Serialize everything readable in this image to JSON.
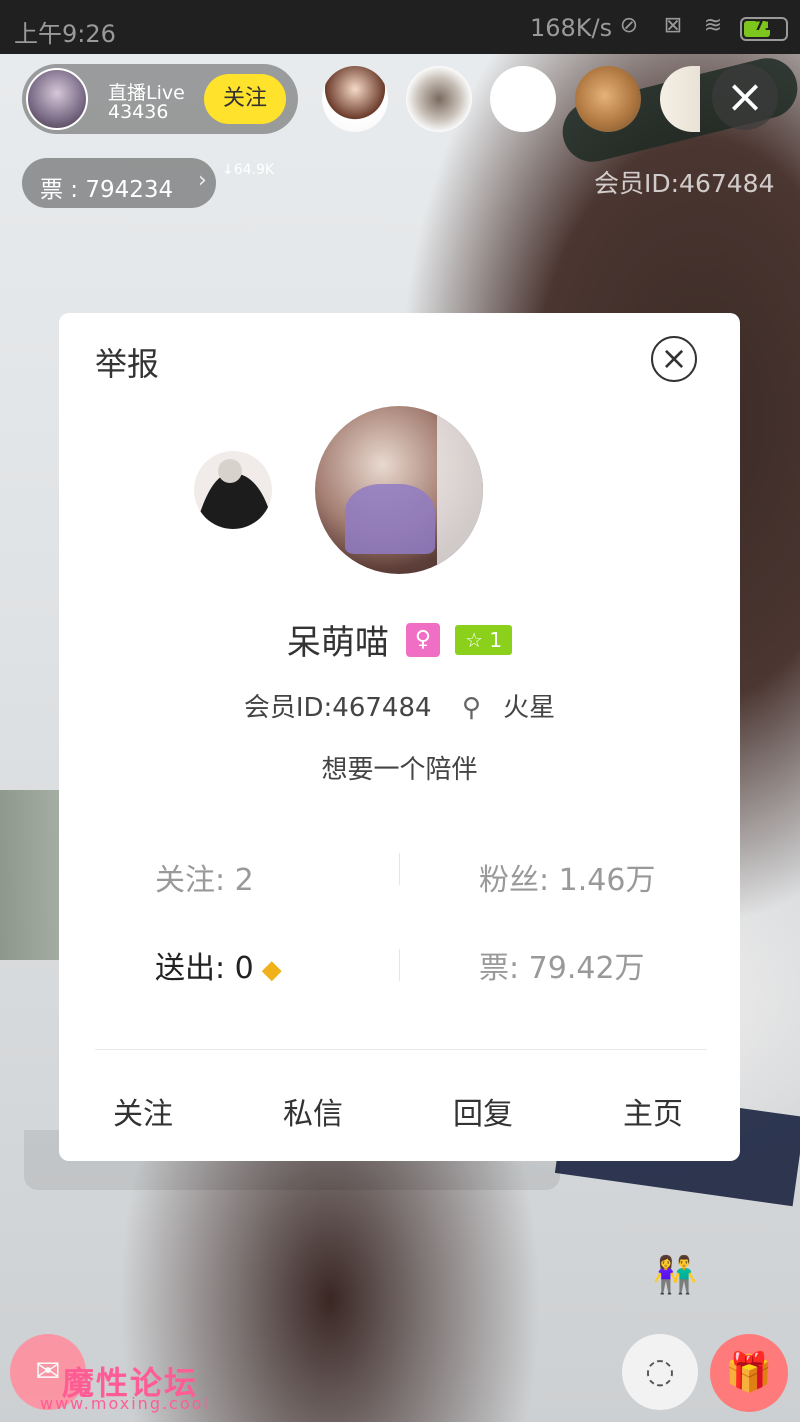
{
  "status_bar": {
    "time": "上午9:26",
    "speed": "168K/s",
    "battery": "71",
    "battery_level": 0.71
  },
  "live_header": {
    "anchor_title": "直播Live",
    "anchor_count": "43436",
    "follow_label": "关注",
    "tickets_label": "票 : 794234",
    "trend": "↓64.9K",
    "member_id": "会员ID:467484"
  },
  "dialog": {
    "title": "举报",
    "nickname": "呆萌喵",
    "gender_symbol": "♀",
    "level": "1",
    "member_id": "会员ID:467484",
    "location": "火星",
    "motto": "想要一个陪伴",
    "stats": {
      "following": "关注: 2",
      "fans": "粉丝: 1.46万",
      "sent": "送出: 0",
      "tickets": "票: 79.42万"
    },
    "actions": {
      "follow": "关注",
      "message": "私信",
      "reply": "回复",
      "homepage": "主页"
    }
  },
  "watermark": {
    "text": "魔性论坛",
    "url": "www.moxing.cool"
  },
  "icons": {
    "close": "close-icon",
    "pin": "location-pin-icon",
    "gem": "diamond-icon",
    "chat": "chat-icon",
    "gift": "gift-icon"
  },
  "colors": {
    "follow_button": "#ffe22c",
    "gender_badge": "#f06fc5",
    "level_badge": "#8bd01a",
    "gift_button": "#ff7b7b"
  }
}
